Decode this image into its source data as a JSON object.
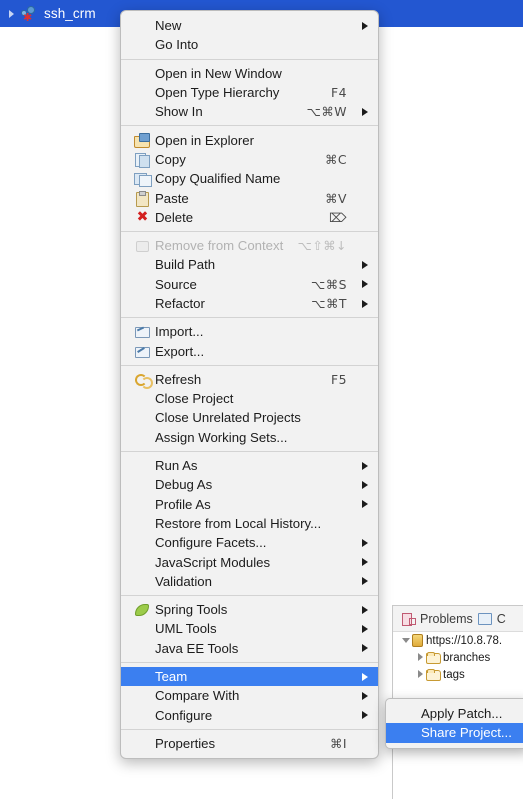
{
  "tree_row": {
    "label": "ssh_crm",
    "icon": "java-project-icon",
    "twisty": "expand-arrow-icon",
    "selected_bg": "#2357d1"
  },
  "background_view": {
    "tabs": [
      {
        "label": "Problems",
        "icon": "problems-icon"
      },
      {
        "label": "C",
        "icon": "console-icon"
      }
    ],
    "tree": [
      {
        "label": "https://10.8.78.",
        "icon": "svn-repository-icon",
        "arrow": "expanded-arrow-icon",
        "level": 1
      },
      {
        "label": "branches",
        "icon": "folder-icon",
        "arrow": "collapsed-arrow-icon",
        "level": 2
      },
      {
        "label": "tags",
        "icon": "folder-icon",
        "arrow": "collapsed-arrow-icon",
        "level": 2
      }
    ]
  },
  "context_menu": {
    "accent_selected": "#3b7ff0",
    "groups": [
      {
        "items": [
          {
            "label": "New",
            "shortcut": "",
            "icon": "",
            "submenu": true,
            "disabled": false,
            "selected": false
          },
          {
            "label": "Go Into",
            "shortcut": "",
            "icon": "",
            "submenu": false,
            "disabled": false,
            "selected": false
          }
        ]
      },
      {
        "items": [
          {
            "label": "Open in New Window",
            "shortcut": "",
            "icon": "",
            "submenu": false,
            "disabled": false,
            "selected": false
          },
          {
            "label": "Open Type Hierarchy",
            "shortcut": "F4",
            "icon": "",
            "submenu": false,
            "disabled": false,
            "selected": false
          },
          {
            "label": "Show In",
            "shortcut": "⌥⌘W",
            "icon": "",
            "submenu": true,
            "disabled": false,
            "selected": false
          }
        ]
      },
      {
        "items": [
          {
            "label": "Open in Explorer",
            "shortcut": "",
            "icon": "ic-explorer",
            "icon_name": "folder-open-icon",
            "submenu": false,
            "disabled": false,
            "selected": false
          },
          {
            "label": "Copy",
            "shortcut": "⌘C",
            "icon": "ic-copy",
            "icon_name": "copy-icon",
            "submenu": false,
            "disabled": false,
            "selected": false
          },
          {
            "label": "Copy Qualified Name",
            "shortcut": "",
            "icon": "ic-copyq",
            "icon_name": "copy-qualified-icon",
            "submenu": false,
            "disabled": false,
            "selected": false
          },
          {
            "label": "Paste",
            "shortcut": "⌘V",
            "icon": "ic-paste",
            "icon_name": "paste-icon",
            "submenu": false,
            "disabled": false,
            "selected": false
          },
          {
            "label": "Delete",
            "shortcut": "⌦",
            "icon": "ic-delete",
            "icon_name": "delete-icon",
            "icon_glyph": "✖",
            "submenu": false,
            "disabled": false,
            "selected": false
          }
        ]
      },
      {
        "items": [
          {
            "label": "Remove from Context",
            "shortcut": "⌥⇧⌘↓",
            "icon": "ic-remctx",
            "icon_name": "remove-context-icon",
            "submenu": false,
            "disabled": true,
            "selected": false
          },
          {
            "label": "Build Path",
            "shortcut": "",
            "icon": "",
            "submenu": true,
            "disabled": false,
            "selected": false
          },
          {
            "label": "Source",
            "shortcut": "⌥⌘S",
            "icon": "",
            "submenu": true,
            "disabled": false,
            "selected": false
          },
          {
            "label": "Refactor",
            "shortcut": "⌥⌘T",
            "icon": "",
            "submenu": true,
            "disabled": false,
            "selected": false
          }
        ]
      },
      {
        "items": [
          {
            "label": "Import...",
            "shortcut": "",
            "icon": "ic-import",
            "icon_name": "import-icon",
            "submenu": false,
            "disabled": false,
            "selected": false
          },
          {
            "label": "Export...",
            "shortcut": "",
            "icon": "ic-export",
            "icon_name": "export-icon",
            "submenu": false,
            "disabled": false,
            "selected": false
          }
        ]
      },
      {
        "items": [
          {
            "label": "Refresh",
            "shortcut": "F5",
            "icon": "ic-refresh",
            "icon_name": "refresh-icon",
            "submenu": false,
            "disabled": false,
            "selected": false
          },
          {
            "label": "Close Project",
            "shortcut": "",
            "icon": "",
            "submenu": false,
            "disabled": false,
            "selected": false
          },
          {
            "label": "Close Unrelated Projects",
            "shortcut": "",
            "icon": "",
            "submenu": false,
            "disabled": false,
            "selected": false
          },
          {
            "label": "Assign Working Sets...",
            "shortcut": "",
            "icon": "",
            "submenu": false,
            "disabled": false,
            "selected": false
          }
        ]
      },
      {
        "items": [
          {
            "label": "Run As",
            "shortcut": "",
            "icon": "",
            "submenu": true,
            "disabled": false,
            "selected": false
          },
          {
            "label": "Debug As",
            "shortcut": "",
            "icon": "",
            "submenu": true,
            "disabled": false,
            "selected": false
          },
          {
            "label": "Profile As",
            "shortcut": "",
            "icon": "",
            "submenu": true,
            "disabled": false,
            "selected": false
          },
          {
            "label": "Restore from Local History...",
            "shortcut": "",
            "icon": "",
            "submenu": false,
            "disabled": false,
            "selected": false
          },
          {
            "label": "Configure Facets...",
            "shortcut": "",
            "icon": "",
            "submenu": true,
            "disabled": false,
            "selected": false
          },
          {
            "label": "JavaScript Modules",
            "shortcut": "",
            "icon": "",
            "submenu": true,
            "disabled": false,
            "selected": false
          },
          {
            "label": "Validation",
            "shortcut": "",
            "icon": "",
            "submenu": true,
            "disabled": false,
            "selected": false
          }
        ]
      },
      {
        "items": [
          {
            "label": "Spring Tools",
            "shortcut": "",
            "icon": "ic-spring",
            "icon_name": "spring-leaf-icon",
            "submenu": true,
            "disabled": false,
            "selected": false
          },
          {
            "label": "UML Tools",
            "shortcut": "",
            "icon": "",
            "submenu": true,
            "disabled": false,
            "selected": false
          },
          {
            "label": "Java EE Tools",
            "shortcut": "",
            "icon": "",
            "submenu": true,
            "disabled": false,
            "selected": false
          }
        ]
      },
      {
        "items": [
          {
            "label": "Team",
            "shortcut": "",
            "icon": "",
            "submenu": true,
            "disabled": false,
            "selected": true
          },
          {
            "label": "Compare With",
            "shortcut": "",
            "icon": "",
            "submenu": true,
            "disabled": false,
            "selected": false
          },
          {
            "label": "Configure",
            "shortcut": "",
            "icon": "",
            "submenu": true,
            "disabled": false,
            "selected": false
          }
        ]
      },
      {
        "items": [
          {
            "label": "Properties",
            "shortcut": "⌘I",
            "icon": "",
            "submenu": false,
            "disabled": false,
            "selected": false
          }
        ]
      }
    ]
  },
  "team_submenu": {
    "items": [
      {
        "label": "Apply Patch...",
        "selected": false
      },
      {
        "label": "Share Project...",
        "selected": true
      }
    ]
  }
}
